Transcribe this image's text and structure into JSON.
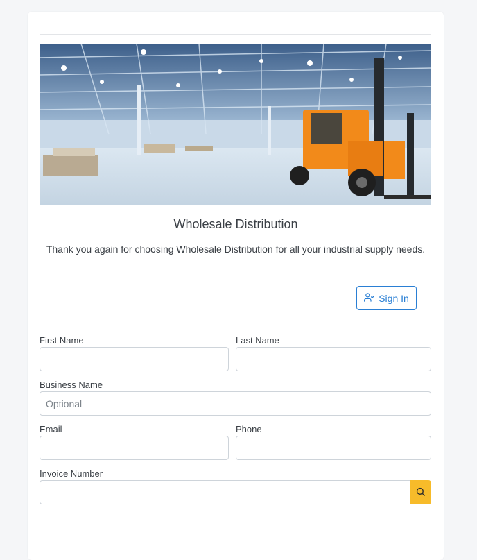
{
  "brand": {
    "title": "Wholesale Distribution",
    "subtitle": "Thank you again for choosing Wholesale Distribution for all your industrial supply needs."
  },
  "hero": {
    "image": "warehouse-forklift-photo",
    "accent_color": "#f28a1a"
  },
  "signin": {
    "label": "Sign In",
    "icon": "user-check-icon",
    "color": "#2a7fd4"
  },
  "form": {
    "first_name": {
      "label": "First Name",
      "value": "",
      "placeholder": ""
    },
    "last_name": {
      "label": "Last Name",
      "value": "",
      "placeholder": ""
    },
    "business_name": {
      "label": "Business Name",
      "value": "",
      "placeholder": "Optional"
    },
    "email": {
      "label": "Email",
      "value": "",
      "placeholder": ""
    },
    "phone": {
      "label": "Phone",
      "value": "",
      "placeholder": ""
    },
    "invoice_number": {
      "label": "Invoice Number",
      "value": "",
      "placeholder": ""
    },
    "search_icon": "search-icon",
    "search_color": "#f7bb2a"
  }
}
